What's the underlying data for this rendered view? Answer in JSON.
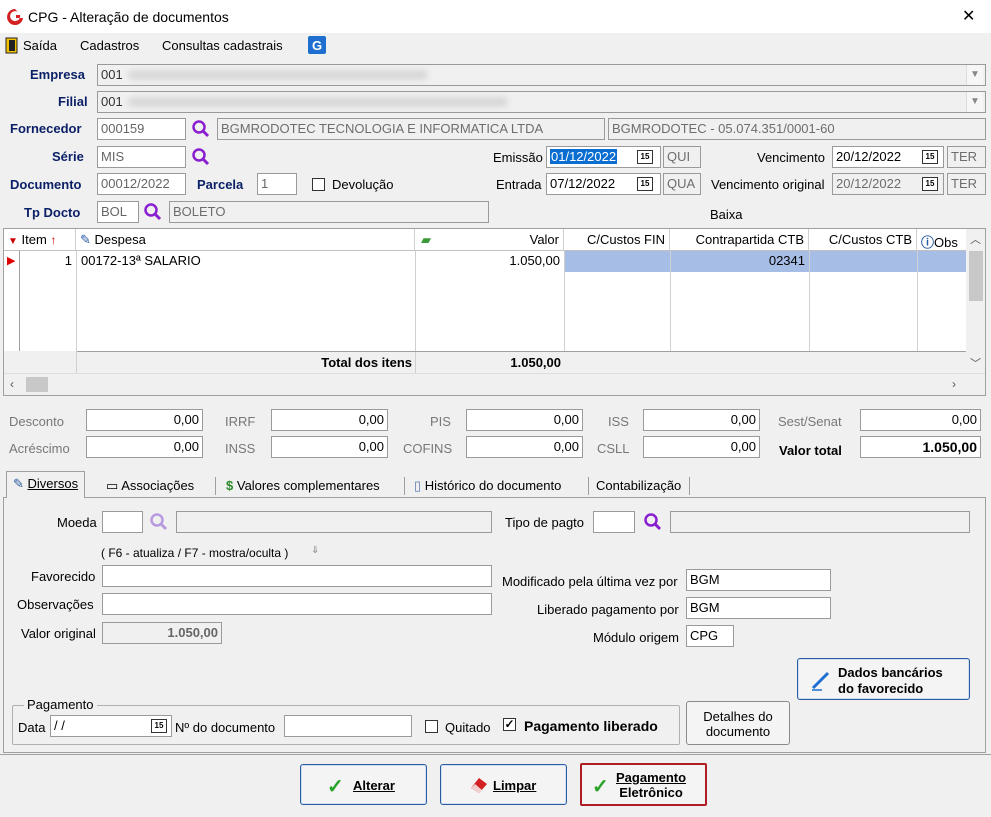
{
  "window": {
    "title": "CPG - Alteração de documentos",
    "close": "✕"
  },
  "menu": [
    "Saída",
    "Cadastros",
    "Consultas cadastrais"
  ],
  "header": {
    "empresa": {
      "label": "Empresa",
      "value": "001"
    },
    "filial": {
      "label": "Filial",
      "value": "001"
    },
    "fornecedor": {
      "label": "Fornecedor",
      "code": "000159",
      "name": "BGMRODOTEC TECNOLOGIA E INFORMATICA LTDA",
      "doc": "BGMRODOTEC - 05.074.351/0001-60"
    },
    "serie": {
      "label": "Série",
      "value": "MIS"
    },
    "documento": {
      "label": "Documento",
      "value": "00012/2022"
    },
    "parcela": {
      "label": "Parcela",
      "value": "1"
    },
    "devolucao": {
      "label": "Devolução"
    },
    "tpdocto": {
      "label": "Tp Docto",
      "code": "BOL",
      "name": "BOLETO"
    },
    "emissao": {
      "label": "Emissão",
      "value": "01/12/2022",
      "day": "QUI"
    },
    "entrada": {
      "label": "Entrada",
      "value": "07/12/2022",
      "day": "QUA"
    },
    "vencimento": {
      "label": "Vencimento",
      "value": "20/12/2022",
      "day": "TER"
    },
    "vencimento_original": {
      "label": "Vencimento original",
      "value": "20/12/2022",
      "day": "TER"
    },
    "baixa": {
      "label": "Baixa"
    },
    "cal_glyph": "15"
  },
  "grid": {
    "columns": [
      "Item",
      "Despesa",
      "Valor",
      "C/Custos FIN",
      "Contrapartida CTB",
      "C/Custos CTB",
      "Obs"
    ],
    "row": {
      "item": "1",
      "despesa": "00172-13ª SALARIO",
      "valor": "1.050,00",
      "contrapartida": "02341"
    },
    "total_label": "Total dos itens",
    "total_value": "1.050,00"
  },
  "totals": {
    "desconto": {
      "label": "Desconto",
      "value": "0,00"
    },
    "acrescimo": {
      "label": "Acréscimo",
      "value": "0,00"
    },
    "irrf": {
      "label": "IRRF",
      "value": "0,00"
    },
    "inss": {
      "label": "INSS",
      "value": "0,00"
    },
    "pis": {
      "label": "PIS",
      "value": "0,00"
    },
    "cofins": {
      "label": "COFINS",
      "value": "0,00"
    },
    "iss": {
      "label": "ISS",
      "value": "0,00"
    },
    "csll": {
      "label": "CSLL",
      "value": "0,00"
    },
    "sest": {
      "label": "Sest/Senat",
      "value": "0,00"
    },
    "valor_total": {
      "label": "Valor total",
      "value": "1.050,00"
    }
  },
  "tabs": [
    "Diversos",
    "Associações",
    "Valores complementares",
    "Histórico do documento",
    "Contabilização"
  ],
  "diversos": {
    "moeda": "Moeda",
    "hint": "( F6 - atualiza / F7 - mostra/oculta )",
    "favorecido": "Favorecido",
    "observacoes": "Observações",
    "valor_original": {
      "label": "Valor original",
      "value": "1.050,00"
    },
    "tipo_pagto": "Tipo de pagto",
    "modificado": {
      "label": "Modificado pela última vez por",
      "value": "BGM"
    },
    "liberado": {
      "label": "Liberado pagamento por",
      "value": "BGM"
    },
    "modulo": {
      "label": "Módulo origem",
      "value": "CPG"
    },
    "dados_bancarios": [
      "Dados bancários",
      "do favorecido"
    ],
    "pagamento": {
      "group": "Pagamento",
      "data_label": "Data",
      "data_value": " /  /",
      "ndoc_label": "Nº do documento",
      "quitado": "Quitado",
      "liberado": "Pagamento liberado"
    },
    "detalhes": [
      "Detalhes do",
      "documento"
    ]
  },
  "buttons": {
    "alterar": "Alterar",
    "limpar": "Limpar",
    "pagamento": [
      "Pagamento",
      "Eletrônico"
    ]
  },
  "colors": {
    "accent": "#0a1f66",
    "selection": "#a6bde6",
    "highlight": "#b01c24"
  }
}
